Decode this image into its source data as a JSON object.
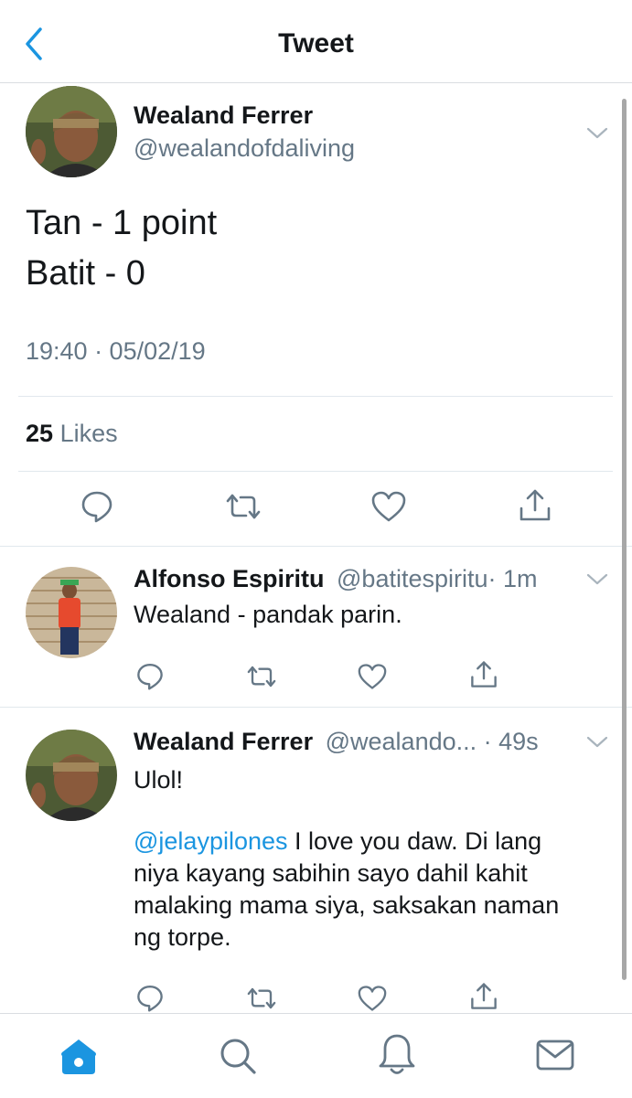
{
  "header": {
    "title": "Tweet",
    "back_icon": "chevron-left-icon"
  },
  "colors": {
    "accent": "#1b95e0",
    "secondary_text": "#657786",
    "divider": "#e1e8ed"
  },
  "main_tweet": {
    "display_name": "Wealand Ferrer",
    "handle": "@wealandofdaliving",
    "lines": [
      "Tan - 1 point",
      "Batit - 0"
    ],
    "timestamp": "19:40 · 05/02/19",
    "likes_count": "25",
    "likes_label": "Likes",
    "actions": [
      "reply-icon",
      "retweet-icon",
      "like-icon",
      "share-icon"
    ]
  },
  "replies": [
    {
      "display_name": "Alfonso Espiritu",
      "handle": "@batitespiritu",
      "time": "· 1m",
      "text": "Wealand - pandak parin."
    },
    {
      "display_name": "Wealand Ferrer",
      "handle": "@wealando...",
      "time": "· 49s",
      "line1": "Ulol!",
      "mention": "@jelaypilones",
      "line2_rest": " I love you daw. Di lang",
      "line3": "niya kayang sabihin sayo dahil kahit",
      "line4": "malaking mama siya, saksakan naman",
      "line5": "ng torpe."
    }
  ],
  "tabbar": {
    "tabs": [
      "home-icon",
      "search-icon",
      "notifications-icon",
      "messages-icon"
    ],
    "active": "home-icon"
  }
}
